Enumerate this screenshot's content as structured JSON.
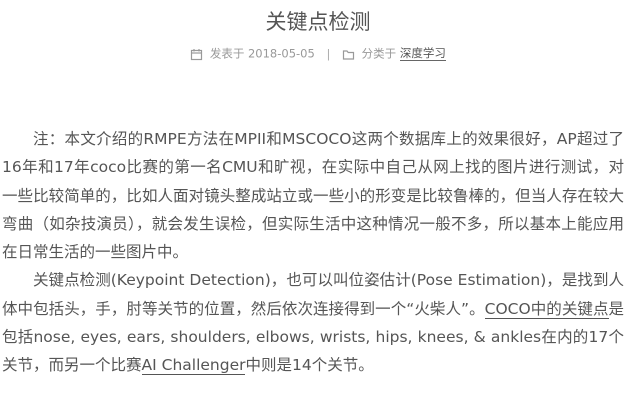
{
  "post": {
    "title": "关键点检测",
    "meta": {
      "posted_label": "发表于",
      "date": "2018-05-05",
      "separator": "|",
      "category_label": "分类于",
      "category": "深度学习"
    },
    "paragraphs": [
      {
        "text": "注：本文介绍的RMPE方法在MPII和MSCOCO这两个数据库上的效果很好，AP超过了16年和17年coco比赛的第一名CMU和旷视，在实际中自己从网上找的图片进行测试，对一些比较简单的，比如人面对镜头整成站立或一些小的形变是比较鲁棒的，但当人存在较大弯曲（如杂技演员），就会发生误检，但实际生活中这种情况一般不多，所以基本上能应用在日常生活的一些图片中。"
      },
      {
        "part1": "关键点检测(Keypoint Detection)，也可以叫位姿估计(Pose Estimation)，是找到人体中包括头，手，肘等关节的位置，然后依次连接得到一个“火柴人”。",
        "link1": "COCO中的关键点",
        "part2": "是包括nose, eyes, ears, shoulders, elbows, wrists, hips, knees, & ankles在内的17个关节，而另一个比赛",
        "link2": "AI Challenger",
        "part3": "中则是14个关节。"
      }
    ]
  },
  "icons": {
    "calendar": "calendar-icon",
    "folder": "folder-icon"
  },
  "colors": {
    "text": "#555555",
    "meta": "#999999",
    "background": "#ffffff"
  }
}
